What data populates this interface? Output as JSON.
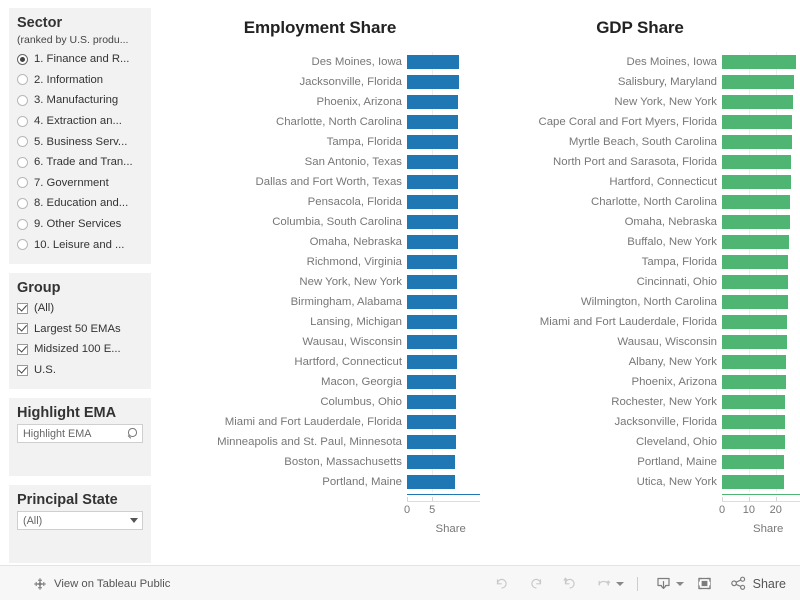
{
  "sidebar": {
    "sector_filter": {
      "title": "Sector",
      "subtitle": "(ranked by U.S. produ...",
      "options": [
        {
          "label": "1. Finance and R...",
          "selected": true
        },
        {
          "label": "2. Information",
          "selected": false
        },
        {
          "label": "3. Manufacturing",
          "selected": false
        },
        {
          "label": "4. Extraction an...",
          "selected": false
        },
        {
          "label": "5. Business Serv...",
          "selected": false
        },
        {
          "label": "6. Trade and Tran...",
          "selected": false
        },
        {
          "label": "7. Government",
          "selected": false
        },
        {
          "label": "8. Education and...",
          "selected": false
        },
        {
          "label": "9. Other Services",
          "selected": false
        },
        {
          "label": "10. Leisure and ...",
          "selected": false
        }
      ]
    },
    "group_filter": {
      "title": "Group",
      "options": [
        {
          "label": "(All)",
          "checked": true
        },
        {
          "label": "Largest 50 EMAs",
          "checked": true
        },
        {
          "label": "Midsized 100 E...",
          "checked": true
        },
        {
          "label": "U.S.",
          "checked": true
        }
      ]
    },
    "highlight_filter": {
      "title": "Highlight EMA",
      "value": "Highlight EMA",
      "placeholder": "Highlight EMA"
    },
    "state_filter": {
      "title": "Principal State",
      "value": "(All)"
    }
  },
  "chart_data": [
    {
      "type": "bar",
      "orientation": "horizontal",
      "title": "Employment Share",
      "xlabel": "Share",
      "ylabel": "",
      "color": "#1f77b4",
      "xlim": [
        0,
        14.5
      ],
      "ticks": [
        0,
        5
      ],
      "grid": true,
      "legend": "none",
      "categories": [
        "Des Moines, Iowa",
        "Jacksonville, Florida",
        "Phoenix, Arizona",
        "Charlotte, North Carolina",
        "Tampa, Florida",
        "San Antonio, Texas",
        "Dallas and Fort Worth, Texas",
        "Pensacola, Florida",
        "Columbia, South Carolina",
        "Omaha, Nebraska",
        "Richmond, Virginia",
        "New York, New York",
        "Birmingham, Alabama",
        "Lansing, Michigan",
        "Wausau, Wisconsin",
        "Hartford, Connecticut",
        "Macon, Georgia",
        "Columbus, Ohio",
        "Miami and Fort Lauderdale, Florida",
        "Minneapolis and St. Paul, Minnesota",
        "Boston, Massachusetts",
        "Portland, Maine"
      ],
      "values": [
        10.3,
        10.3,
        10.2,
        10.2,
        10.2,
        10.1,
        10.1,
        10.1,
        10.1,
        10.1,
        10.0,
        10.0,
        10.0,
        10.0,
        9.9,
        9.9,
        9.8,
        9.8,
        9.8,
        9.7,
        9.5,
        9.5
      ]
    },
    {
      "type": "bar",
      "orientation": "horizontal",
      "title": "GDP Share",
      "xlabel": "Share",
      "ylabel": "",
      "color": "#4fb573",
      "xlim": [
        0,
        29
      ],
      "ticks": [
        0,
        10,
        20
      ],
      "grid": true,
      "legend": "none",
      "categories": [
        "Des Moines, Iowa",
        "Salisbury, Maryland",
        "New York, New York",
        "Cape Coral and Fort Myers, Florida",
        "Myrtle Beach, South Carolina",
        "North Port and Sarasota, Florida",
        "Hartford, Connecticut",
        "Charlotte, North Carolina",
        "Omaha, Nebraska",
        "Buffalo, New York",
        "Tampa, Florida",
        "Cincinnati, Ohio",
        "Wilmington, North Carolina",
        "Miami and Fort Lauderdale, Florida",
        "Wausau, Wisconsin",
        "Albany, New York",
        "Phoenix, Arizona",
        "Rochester, New York",
        "Jacksonville, Florida",
        "Cleveland, Ohio",
        "Portland, Maine",
        "Utica, New York"
      ],
      "values": [
        27.5,
        26.8,
        26.4,
        26.1,
        25.9,
        25.7,
        25.5,
        25.3,
        25.1,
        24.9,
        24.7,
        24.5,
        24.4,
        24.2,
        24.1,
        23.9,
        23.8,
        23.6,
        23.5,
        23.3,
        23.1,
        23.0
      ]
    }
  ],
  "toolbar": {
    "tableau_link_label": "View on Tableau Public",
    "share_label": "Share",
    "buttons": [
      {
        "name": "undo",
        "title": "Undo"
      },
      {
        "name": "redo",
        "title": "Redo"
      },
      {
        "name": "revert",
        "title": "Revert"
      },
      {
        "name": "refresh",
        "title": "Refresh"
      },
      {
        "name": "pause",
        "title": "Pause Updates"
      },
      {
        "name": "download",
        "title": "Download"
      },
      {
        "name": "fullscreen",
        "title": "Full Screen"
      }
    ]
  }
}
